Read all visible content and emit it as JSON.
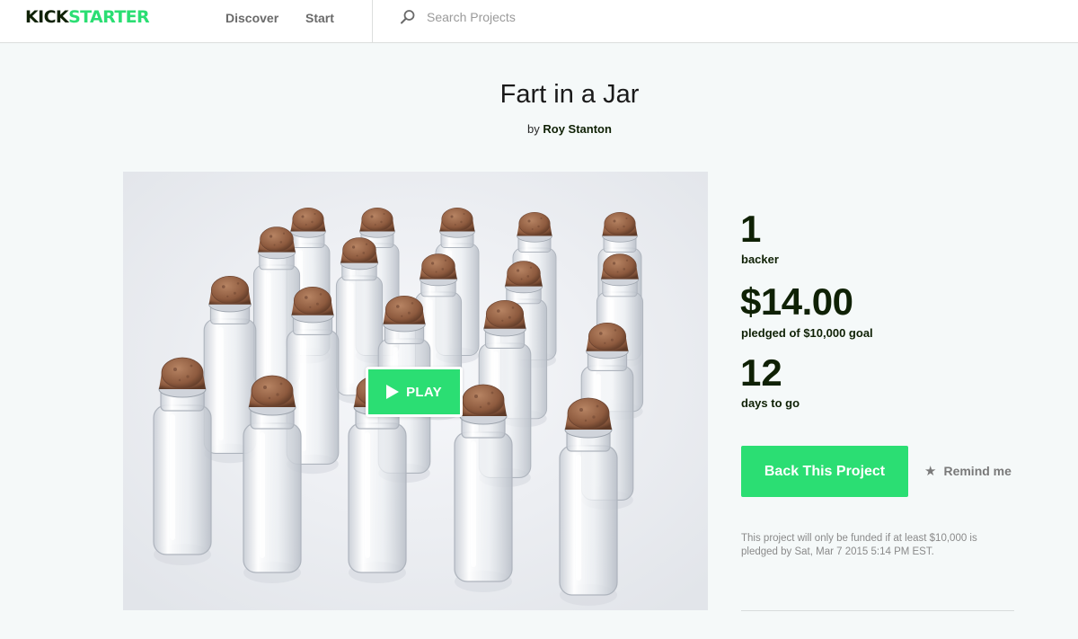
{
  "header": {
    "logo_part1": "KICK",
    "logo_part2": "STARTER",
    "nav": {
      "discover": "Discover",
      "start": "Start"
    },
    "search": {
      "placeholder": "Search Projects",
      "icon": "search-icon"
    }
  },
  "project": {
    "title": "Fart in a Jar",
    "by_prefix": "by",
    "creator": "Roy Stanton"
  },
  "media": {
    "play_label": "PLAY",
    "play_icon": "play-icon"
  },
  "stats": {
    "backers": "1",
    "backers_label": "backer",
    "pledged": "$14.00",
    "pledged_label": "pledged of $10,000 goal",
    "days": "12",
    "days_label": "days to go"
  },
  "actions": {
    "back_label": "Back This Project",
    "remind_label": "Remind me",
    "remind_icon": "star-icon"
  },
  "funding_note": "This project will only be funded if at least $10,000 is pledged by Sat, Mar 7 2015 5:14 PM EST.",
  "colors": {
    "accent": "#2bde73",
    "dark": "#0f2105",
    "background": "#f5f9f9"
  }
}
